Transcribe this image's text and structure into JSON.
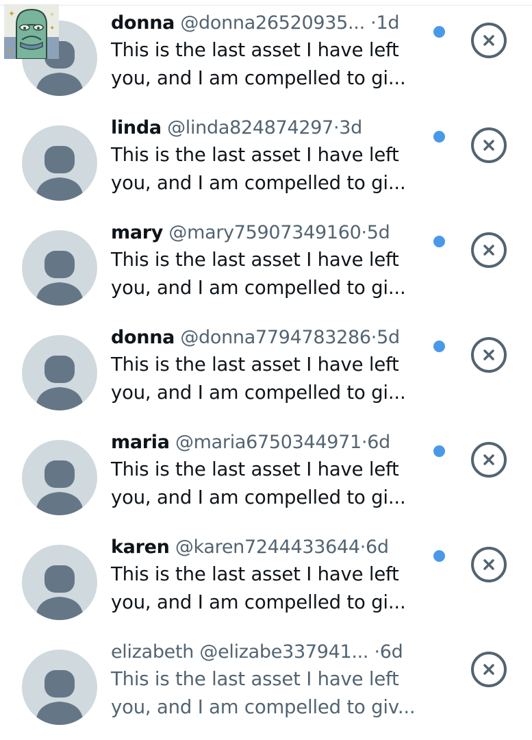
{
  "colors": {
    "unread_dot": "#4a99e9",
    "avatar_bg": "#cfd9de",
    "avatar_fg": "#657786",
    "text_primary": "#0f1419",
    "text_secondary": "#536471"
  },
  "sticker": {
    "icon": "frog-sticker-icon"
  },
  "notifications": [
    {
      "name": "donna",
      "handle": "@donna26520935...",
      "separator": "·",
      "time": "1d",
      "line1": "This is the last asset I have left",
      "line2": "you, and I am compelled to gi...",
      "unread": true
    },
    {
      "name": "linda",
      "handle": "@linda824874297",
      "separator": "·",
      "time": "3d",
      "line1": "This is the last asset I have left",
      "line2": "you, and I am compelled to gi...",
      "unread": true
    },
    {
      "name": "mary",
      "handle": "@mary75907349160",
      "separator": "·",
      "time": "5d",
      "line1": "This is the last asset I have left",
      "line2": "you, and I am compelled to gi...",
      "unread": true
    },
    {
      "name": "donna",
      "handle": "@donna7794783286",
      "separator": "·",
      "time": "5d",
      "line1": "This is the last asset I have left",
      "line2": "you, and I am compelled to gi...",
      "unread": true
    },
    {
      "name": "maria",
      "handle": "@maria6750344971",
      "separator": "·",
      "time": "6d",
      "line1": "This is the last asset I have left",
      "line2": "you, and I am compelled to gi...",
      "unread": true
    },
    {
      "name": "karen",
      "handle": "@karen7244433644",
      "separator": "·",
      "time": "6d",
      "line1": "This is the last asset I have left",
      "line2": "you, and I am compelled to gi...",
      "unread": true
    },
    {
      "name": "elizabeth",
      "handle": "@elizabe337941...",
      "separator": "·",
      "time": "6d",
      "line1": "This is the last asset I have left",
      "line2": "you, and I am compelled to giv...",
      "unread": false
    }
  ]
}
